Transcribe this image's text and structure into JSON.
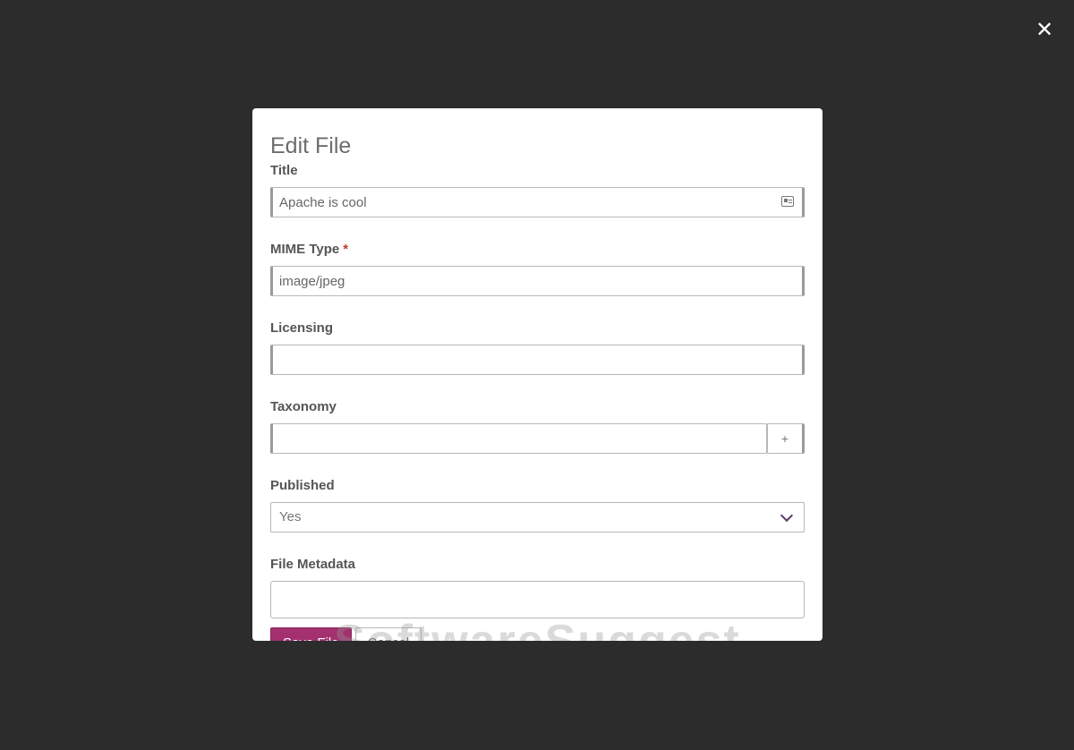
{
  "close_icon": "close-x-icon",
  "modal": {
    "title": "Edit File",
    "fields": {
      "title": {
        "label": "Title",
        "value": "Apache is cool",
        "icon": "id-card-icon"
      },
      "mime_type": {
        "label": "MIME Type",
        "required_mark": "*",
        "value": "image/jpeg"
      },
      "licensing": {
        "label": "Licensing",
        "value": ""
      },
      "taxonomy": {
        "label": "Taxonomy",
        "value": "",
        "add_button_label": "+"
      },
      "published": {
        "label": "Published",
        "selected": "Yes"
      },
      "file_metadata": {
        "label": "File Metadata",
        "value": ""
      }
    },
    "buttons": {
      "save_label": "Save File",
      "cancel_label": "Cancel"
    },
    "watermark": "SoftwareSuggest"
  },
  "colors": {
    "overlay": "#2c2c2c",
    "primary_button": "#a3306f",
    "required": "#c0392b"
  }
}
